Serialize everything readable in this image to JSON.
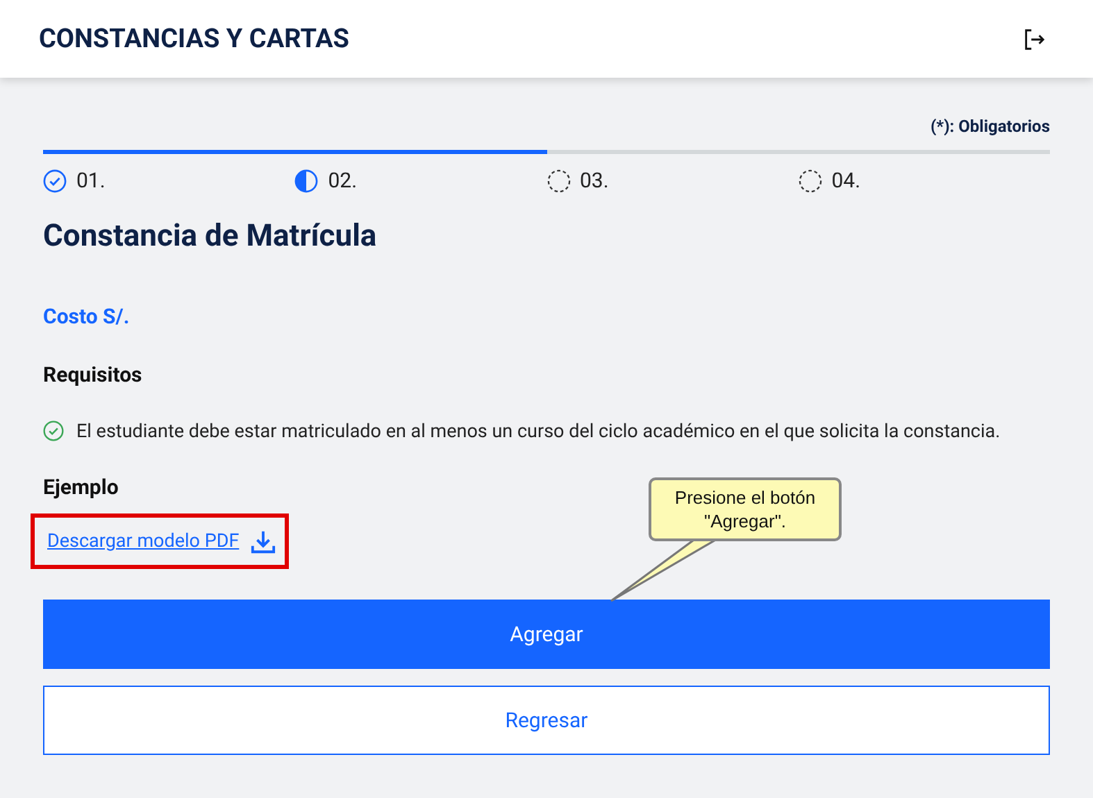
{
  "header": {
    "title": "CONSTANCIAS Y CARTAS"
  },
  "required_note": "(*): Obligatorios",
  "progress": {
    "level": 0.5
  },
  "steps": [
    {
      "label": "01.",
      "kind": "done"
    },
    {
      "label": "02.",
      "kind": "current"
    },
    {
      "label": "03.",
      "kind": "pending"
    },
    {
      "label": "04.",
      "kind": "pending"
    }
  ],
  "title": "Constancia de Matrícula",
  "cost": "Costo S/.",
  "requirements": {
    "heading": "Requisitos",
    "items": [
      "El estudiante debe estar matriculado en al menos un curso del ciclo académico en el que solicita la constancia."
    ]
  },
  "example": {
    "heading": "Ejemplo",
    "link": "Descargar modelo PDF",
    "highlighted": true
  },
  "buttons": [
    {
      "label": "Agregar",
      "kind": "primary"
    },
    {
      "label": "Regresar",
      "kind": "secondary"
    }
  ],
  "callout": {
    "text": "Presione el botón \"Agregar\"."
  }
}
